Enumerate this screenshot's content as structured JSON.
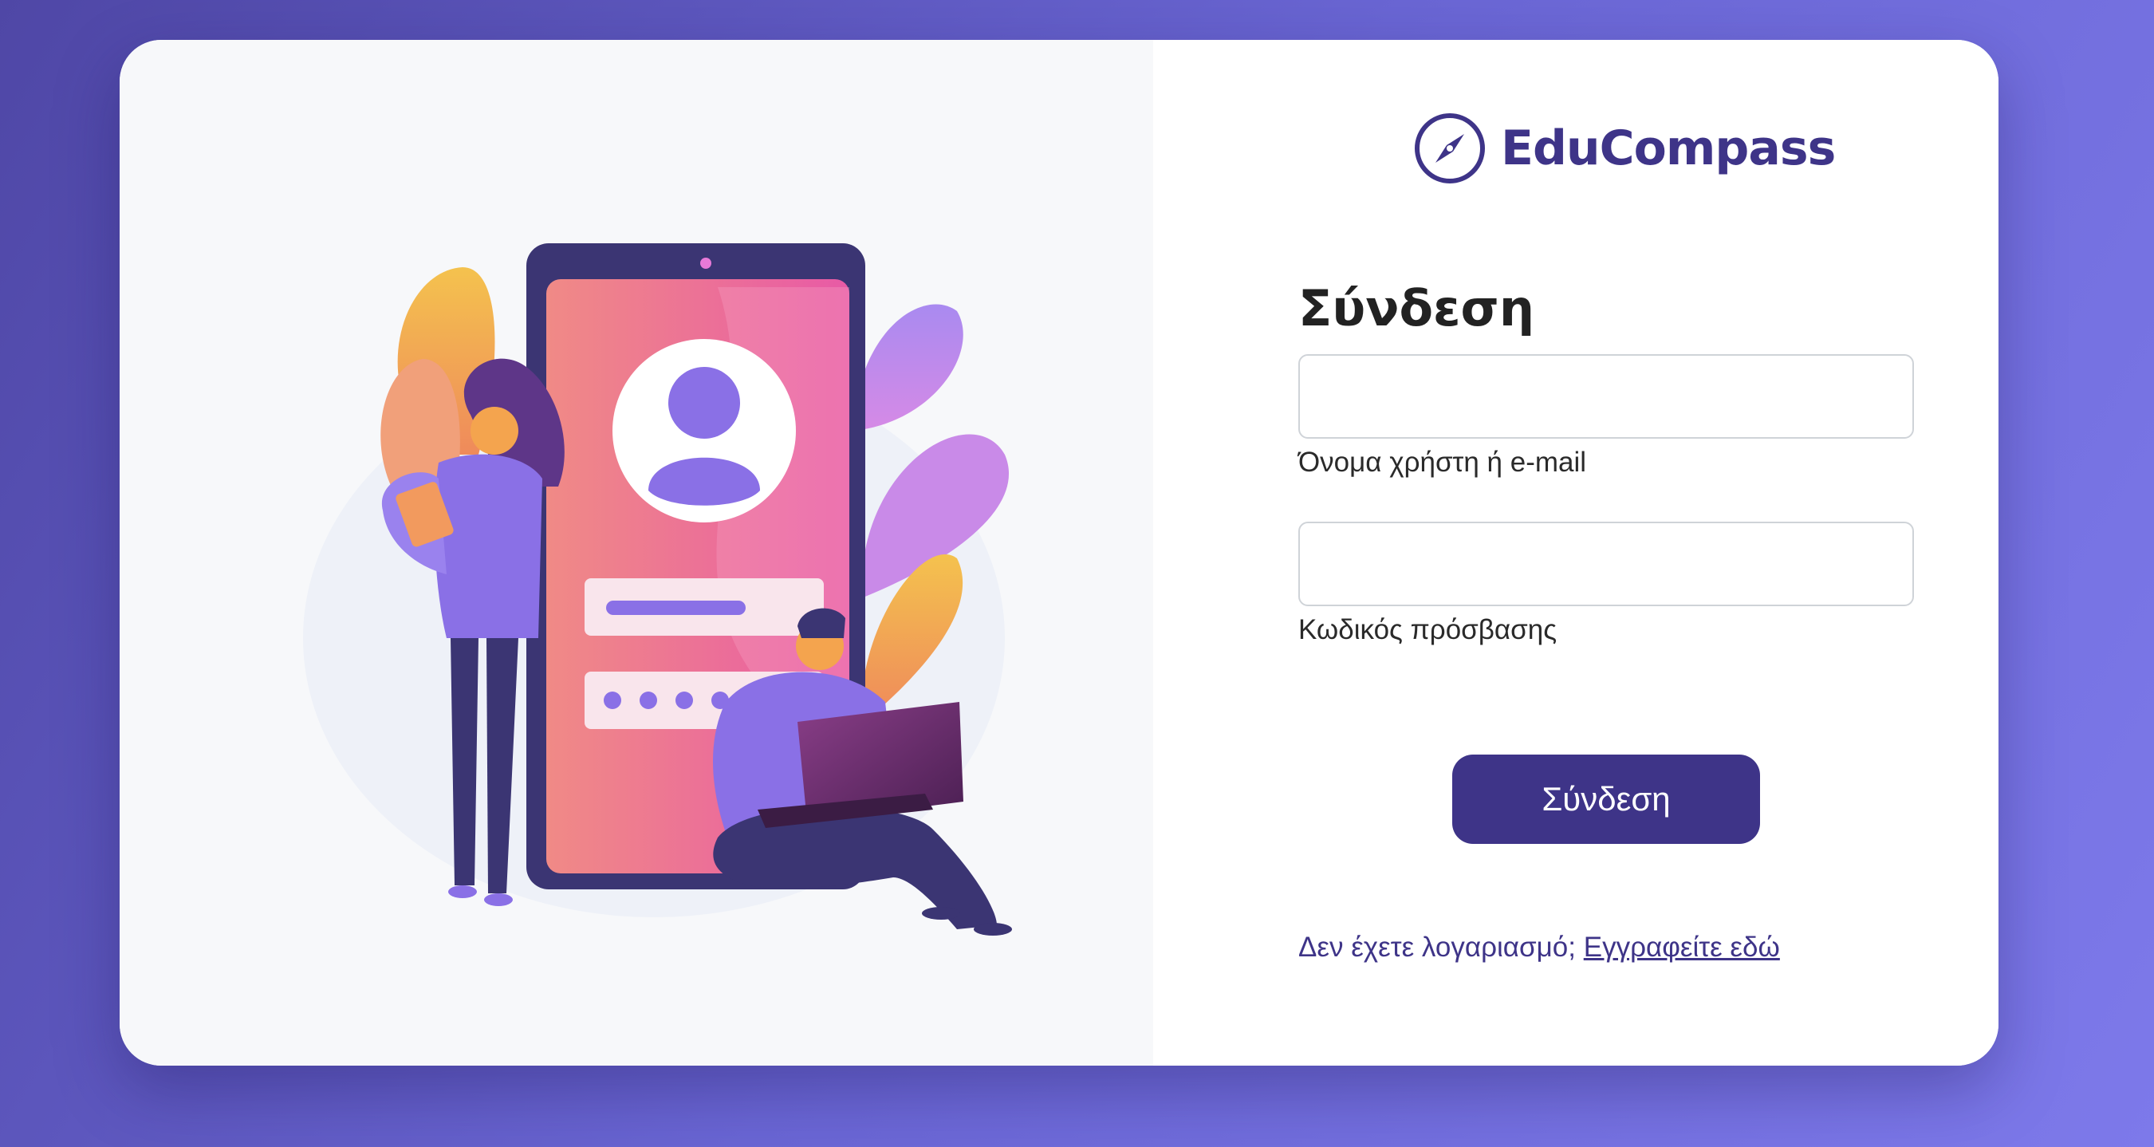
{
  "brand": {
    "name": "EduCompass",
    "logo_icon": "compass-icon",
    "color": "#3e3488"
  },
  "login": {
    "title": "Σύνδεση",
    "username_value": "",
    "username_label": "Όνομα χρήστη ή e-mail",
    "password_value": "",
    "password_label": "Κωδικός πρόσβασης",
    "submit_label": "Σύνδεση",
    "signup_prompt": "Δεν έχετε λογαριασμό;",
    "signup_link": "Εγγραφείτε εδώ"
  },
  "illustration": {
    "icon": "login-illustration",
    "accent": "#8a70e6"
  },
  "colors": {
    "background_start": "#4f47a6",
    "background_end": "#7d79ea",
    "primary": "#3e3488"
  }
}
